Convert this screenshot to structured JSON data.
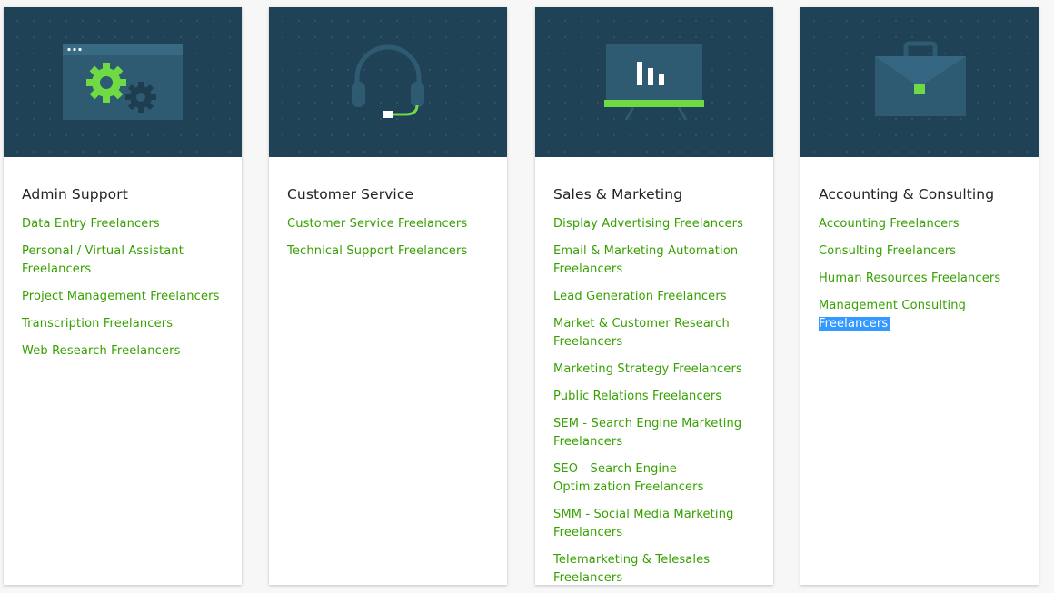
{
  "colors": {
    "card_header_bg": "#1f4256",
    "link": "#37a000",
    "accent_green": "#6fda44",
    "selection": "#3399ff"
  },
  "cards": [
    {
      "icon": "gears-icon",
      "title": "Admin Support",
      "links": [
        "Data Entry Freelancers",
        "Personal / Virtual Assistant Freelancers",
        "Project Management Freelancers",
        "Transcription Freelancers",
        "Web Research Freelancers"
      ]
    },
    {
      "icon": "headset-icon",
      "title": "Customer Service",
      "links": [
        "Customer Service Freelancers",
        "Technical Support Freelancers"
      ]
    },
    {
      "icon": "presentation-board-icon",
      "title": "Sales & Marketing",
      "links": [
        "Display Advertising Freelancers",
        "Email & Marketing Automation Freelancers",
        "Lead Generation Freelancers",
        "Market & Customer Research Freelancers",
        "Marketing Strategy Freelancers",
        "Public Relations Freelancers",
        "SEM - Search Engine Marketing Freelancers",
        "SEO - Search Engine Optimization Freelancers",
        "SMM - Social Media Marketing Freelancers",
        "Telemarketing & Telesales Freelancers"
      ]
    },
    {
      "icon": "briefcase-icon",
      "title": "Accounting & Consulting",
      "links": [
        "Accounting Freelancers",
        "Consulting Freelancers",
        "Human Resources Freelancers"
      ],
      "selected_link": {
        "prefix": "Management Consulting ",
        "selected_text": "Freelancers"
      }
    }
  ]
}
